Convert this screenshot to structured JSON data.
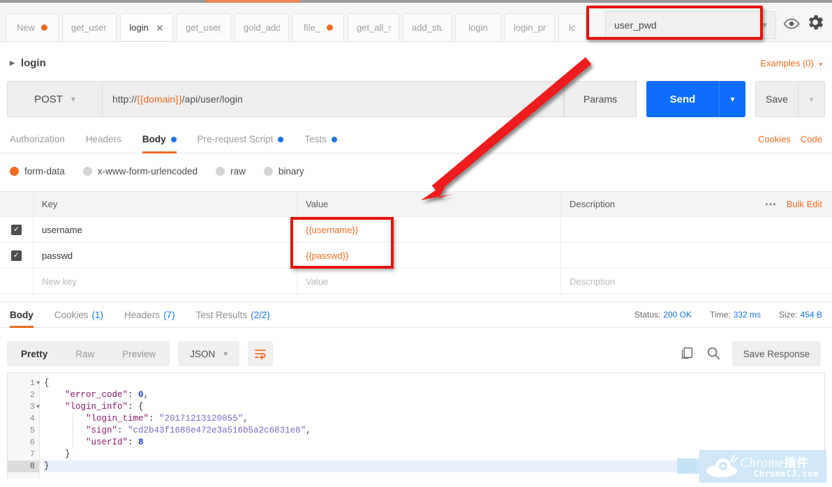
{
  "window": {
    "tabs": [
      {
        "label": "New",
        "dot": true,
        "active": false,
        "closable": false,
        "width": 76
      },
      {
        "label": "get_user_i",
        "dot": false,
        "active": false,
        "closable": false,
        "width": 78
      },
      {
        "label": "login",
        "dot": false,
        "active": true,
        "closable": true,
        "width": 76
      },
      {
        "label": "get_user_i",
        "dot": false,
        "active": false,
        "closable": false,
        "width": 78
      },
      {
        "label": "gold_add",
        "dot": false,
        "active": false,
        "closable": false,
        "width": 78
      },
      {
        "label": "file_",
        "dot": true,
        "active": false,
        "closable": false,
        "width": 74
      },
      {
        "label": "get_all_stu",
        "dot": false,
        "active": false,
        "closable": false,
        "width": 74
      },
      {
        "label": "add_stu",
        "dot": false,
        "active": false,
        "closable": false,
        "width": 70
      },
      {
        "label": "login",
        "dot": false,
        "active": false,
        "closable": false,
        "width": 66
      },
      {
        "label": "login_prer",
        "dot": false,
        "active": false,
        "closable": false,
        "width": 72
      },
      {
        "label": "lc",
        "dot": false,
        "active": false,
        "closable": false,
        "width": 22
      }
    ],
    "environment": {
      "selected": "user_pwd",
      "caret": "chevron-down-icon",
      "eye_icon": "eye-icon",
      "gear_icon": "gear-icon"
    }
  },
  "request": {
    "name": "login",
    "examples_label": "Examples (0)",
    "method": "POST",
    "url_prefix": "http://",
    "url_variable": "{{domain}}",
    "url_suffix": "/api/user/login",
    "params_label": "Params",
    "send_label": "Send",
    "save_label": "Save",
    "tabs": [
      {
        "label": "Authorization",
        "dot": false,
        "active": false
      },
      {
        "label": "Headers",
        "dot": false,
        "active": false
      },
      {
        "label": "Body",
        "dot": true,
        "active": true
      },
      {
        "label": "Pre-request Script",
        "dot": true,
        "active": false
      },
      {
        "label": "Tests",
        "dot": true,
        "active": false
      }
    ],
    "cookies_link": "Cookies",
    "code_link": "Code",
    "body_types": [
      {
        "label": "form-data",
        "checked": true
      },
      {
        "label": "x-www-form-urlencoded",
        "checked": false
      },
      {
        "label": "raw",
        "checked": false
      },
      {
        "label": "binary",
        "checked": false
      }
    ],
    "table": {
      "headers": {
        "key": "Key",
        "value": "Value",
        "description": "Description"
      },
      "dots_menu": "•••",
      "bulk_edit": "Bulk Edit",
      "rows": [
        {
          "checked": true,
          "key": "username",
          "value": "{{username}}",
          "description": "",
          "placeholder": false
        },
        {
          "checked": true,
          "key": "passwd",
          "value": "{{passwd}}",
          "description": "",
          "placeholder": false
        },
        {
          "checked": false,
          "key": "New key",
          "value": "Value",
          "description": "Description",
          "placeholder": true
        }
      ]
    }
  },
  "response": {
    "tabs": [
      {
        "label": "Body",
        "count": "",
        "active": true
      },
      {
        "label": "Cookies",
        "count": "(1)",
        "active": false
      },
      {
        "label": "Headers",
        "count": "(7)",
        "active": false
      },
      {
        "label": "Test Results",
        "count": "(2/2)",
        "active": false
      }
    ],
    "meta": {
      "status_label": "Status:",
      "status_value": "200 OK",
      "time_label": "Time:",
      "time_value": "332 ms",
      "size_label": "Size:",
      "size_value": "454 B"
    },
    "toolbar": {
      "view_modes": [
        {
          "label": "Pretty",
          "active": true
        },
        {
          "label": "Raw",
          "active": false
        },
        {
          "label": "Preview",
          "active": false
        }
      ],
      "format": "JSON",
      "wrap_icon": "word-wrap-icon",
      "copy_icon": "copy-icon",
      "search_icon": "search-icon",
      "save_response_label": "Save Response"
    },
    "code_lines": [
      {
        "num": "1",
        "fold": true,
        "current": false,
        "tokens": [
          {
            "t": "{",
            "c": "p"
          }
        ]
      },
      {
        "num": "2",
        "fold": false,
        "current": false,
        "tokens": [
          {
            "t": "    ",
            "c": "p"
          },
          {
            "t": "\"error_code\"",
            "c": "k"
          },
          {
            "t": ": ",
            "c": "p"
          },
          {
            "t": "0",
            "c": "n"
          },
          {
            "t": ",",
            "c": "p"
          }
        ]
      },
      {
        "num": "3",
        "fold": true,
        "current": false,
        "tokens": [
          {
            "t": "    ",
            "c": "p"
          },
          {
            "t": "\"login_info\"",
            "c": "k"
          },
          {
            "t": ": {",
            "c": "p"
          }
        ]
      },
      {
        "num": "4",
        "fold": false,
        "current": false,
        "tokens": [
          {
            "t": "        ",
            "c": "p"
          },
          {
            "t": "\"login_time\"",
            "c": "k"
          },
          {
            "t": ": ",
            "c": "p"
          },
          {
            "t": "\"20171213120055\"",
            "c": "s"
          },
          {
            "t": ",",
            "c": "p"
          }
        ]
      },
      {
        "num": "5",
        "fold": false,
        "current": false,
        "tokens": [
          {
            "t": "        ",
            "c": "p"
          },
          {
            "t": "\"sign\"",
            "c": "k"
          },
          {
            "t": ": ",
            "c": "p"
          },
          {
            "t": "\"cd2b43f1688e472e3a516b5a2c6831e8\"",
            "c": "s"
          },
          {
            "t": ",",
            "c": "p"
          }
        ]
      },
      {
        "num": "6",
        "fold": false,
        "current": false,
        "tokens": [
          {
            "t": "        ",
            "c": "p"
          },
          {
            "t": "\"userId\"",
            "c": "k"
          },
          {
            "t": ": ",
            "c": "p"
          },
          {
            "t": "8",
            "c": "n"
          }
        ]
      },
      {
        "num": "7",
        "fold": false,
        "current": false,
        "tokens": [
          {
            "t": "    }",
            "c": "p"
          }
        ]
      },
      {
        "num": "8",
        "fold": false,
        "current": true,
        "tokens": [
          {
            "t": "}",
            "c": "p"
          }
        ]
      }
    ]
  },
  "annotations": {
    "highlight_color": "#e4130f",
    "arrow_color": "#ee1c1c",
    "env_box": "red-highlight-box-environment",
    "value_box": "red-highlight-box-values",
    "arrow": "red-arrow-pointing-to-value-column"
  },
  "watermark": {
    "brand": "Chrome",
    "brand_cn": "插件",
    "site": "ChromeCJ.com"
  }
}
